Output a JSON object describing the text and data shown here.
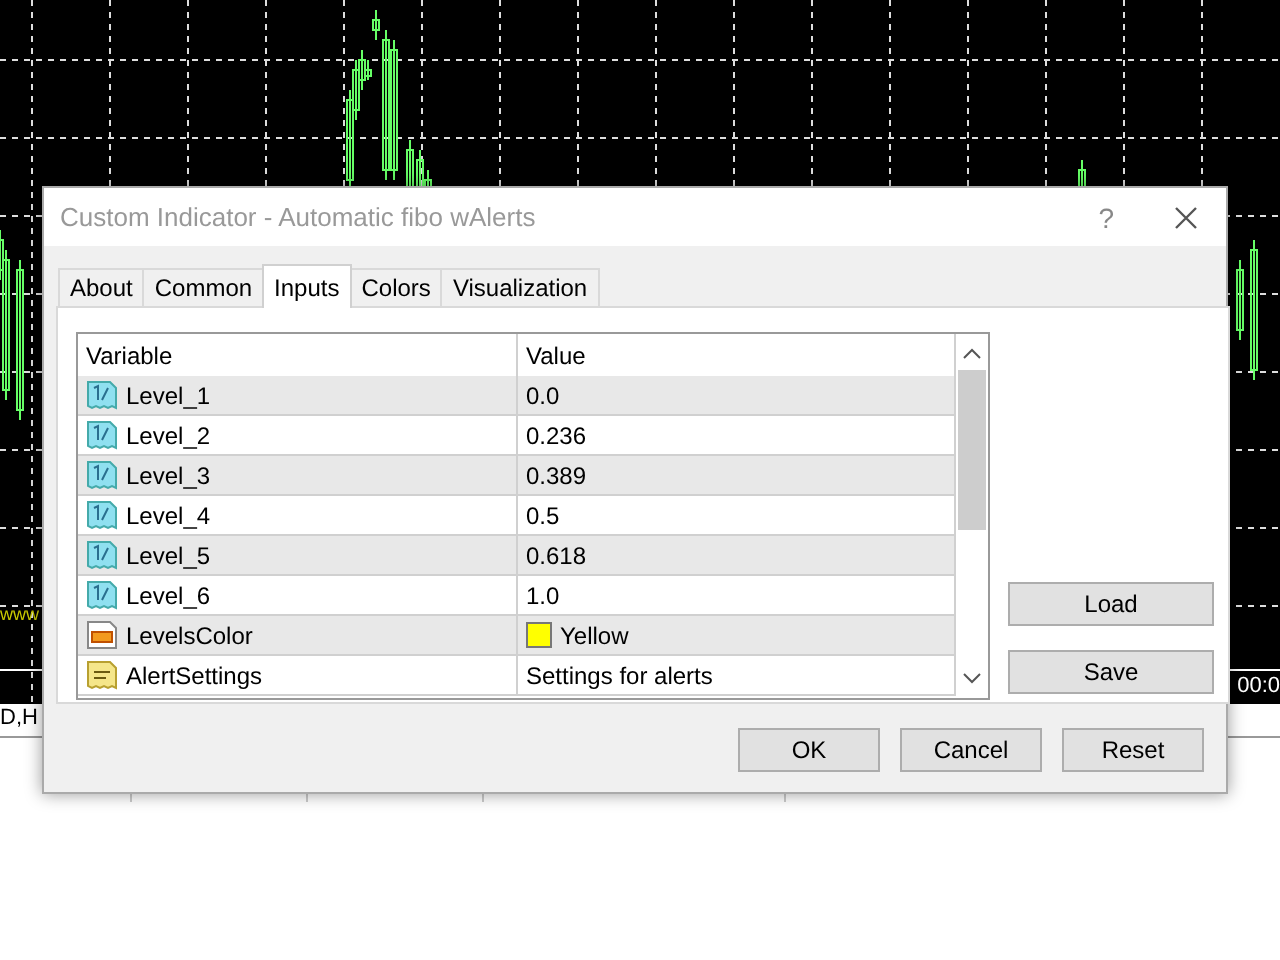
{
  "chart": {
    "watermark_fragment": "www",
    "time_label": "00:0",
    "symbol_tab": "D,H"
  },
  "dialog": {
    "title": "Custom Indicator - Automatic fibo wAlerts",
    "help": "?",
    "tabs": [
      {
        "label": "About",
        "selected": false
      },
      {
        "label": "Common",
        "selected": false
      },
      {
        "label": "Inputs",
        "selected": true
      },
      {
        "label": "Colors",
        "selected": false
      },
      {
        "label": "Visualization",
        "selected": false
      }
    ],
    "inputs": {
      "columns": [
        "Variable",
        "Value"
      ],
      "rows": [
        {
          "kind": "number",
          "variable": "Level_1",
          "value": "0.0"
        },
        {
          "kind": "number",
          "variable": "Level_2",
          "value": "0.236"
        },
        {
          "kind": "number",
          "variable": "Level_3",
          "value": "0.389"
        },
        {
          "kind": "number",
          "variable": "Level_4",
          "value": "0.5"
        },
        {
          "kind": "number",
          "variable": "Level_5",
          "value": "0.618"
        },
        {
          "kind": "number",
          "variable": "Level_6",
          "value": "1.0"
        },
        {
          "kind": "color",
          "variable": "LevelsColor",
          "value": "Yellow",
          "color": "#ffff00"
        },
        {
          "kind": "text",
          "variable": "AlertSettings",
          "value": "Settings for alerts"
        }
      ]
    },
    "side_buttons": [
      "Load",
      "Save"
    ],
    "buttons": [
      "OK",
      "Cancel",
      "Reset"
    ]
  }
}
